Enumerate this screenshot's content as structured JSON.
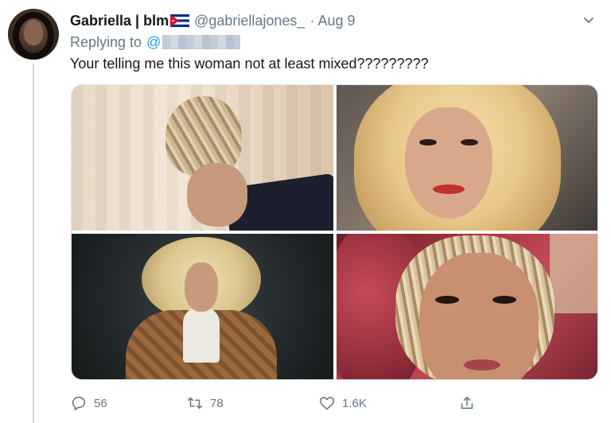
{
  "tweet": {
    "author": {
      "display_name": "Gabriella | blm",
      "handle": "@gabriellajones_",
      "flag_icon": "cuba-flag-icon"
    },
    "separator": "·",
    "date": "Aug 9",
    "replying_to_label": "Replying to",
    "replying_to_mention": "@",
    "text": "Your telling me this woman not at least mixed?????????",
    "media_count": 4,
    "actions": {
      "reply": {
        "icon": "reply-icon",
        "count": "56"
      },
      "retweet": {
        "icon": "retweet-icon",
        "count": "78"
      },
      "like": {
        "icon": "heart-icon",
        "count": "1.6K"
      },
      "share": {
        "icon": "share-icon"
      }
    }
  },
  "colors": {
    "text": "#14171a",
    "secondary_text": "#657786",
    "link": "#1da1f2",
    "thread_line": "#ccd6dd"
  }
}
